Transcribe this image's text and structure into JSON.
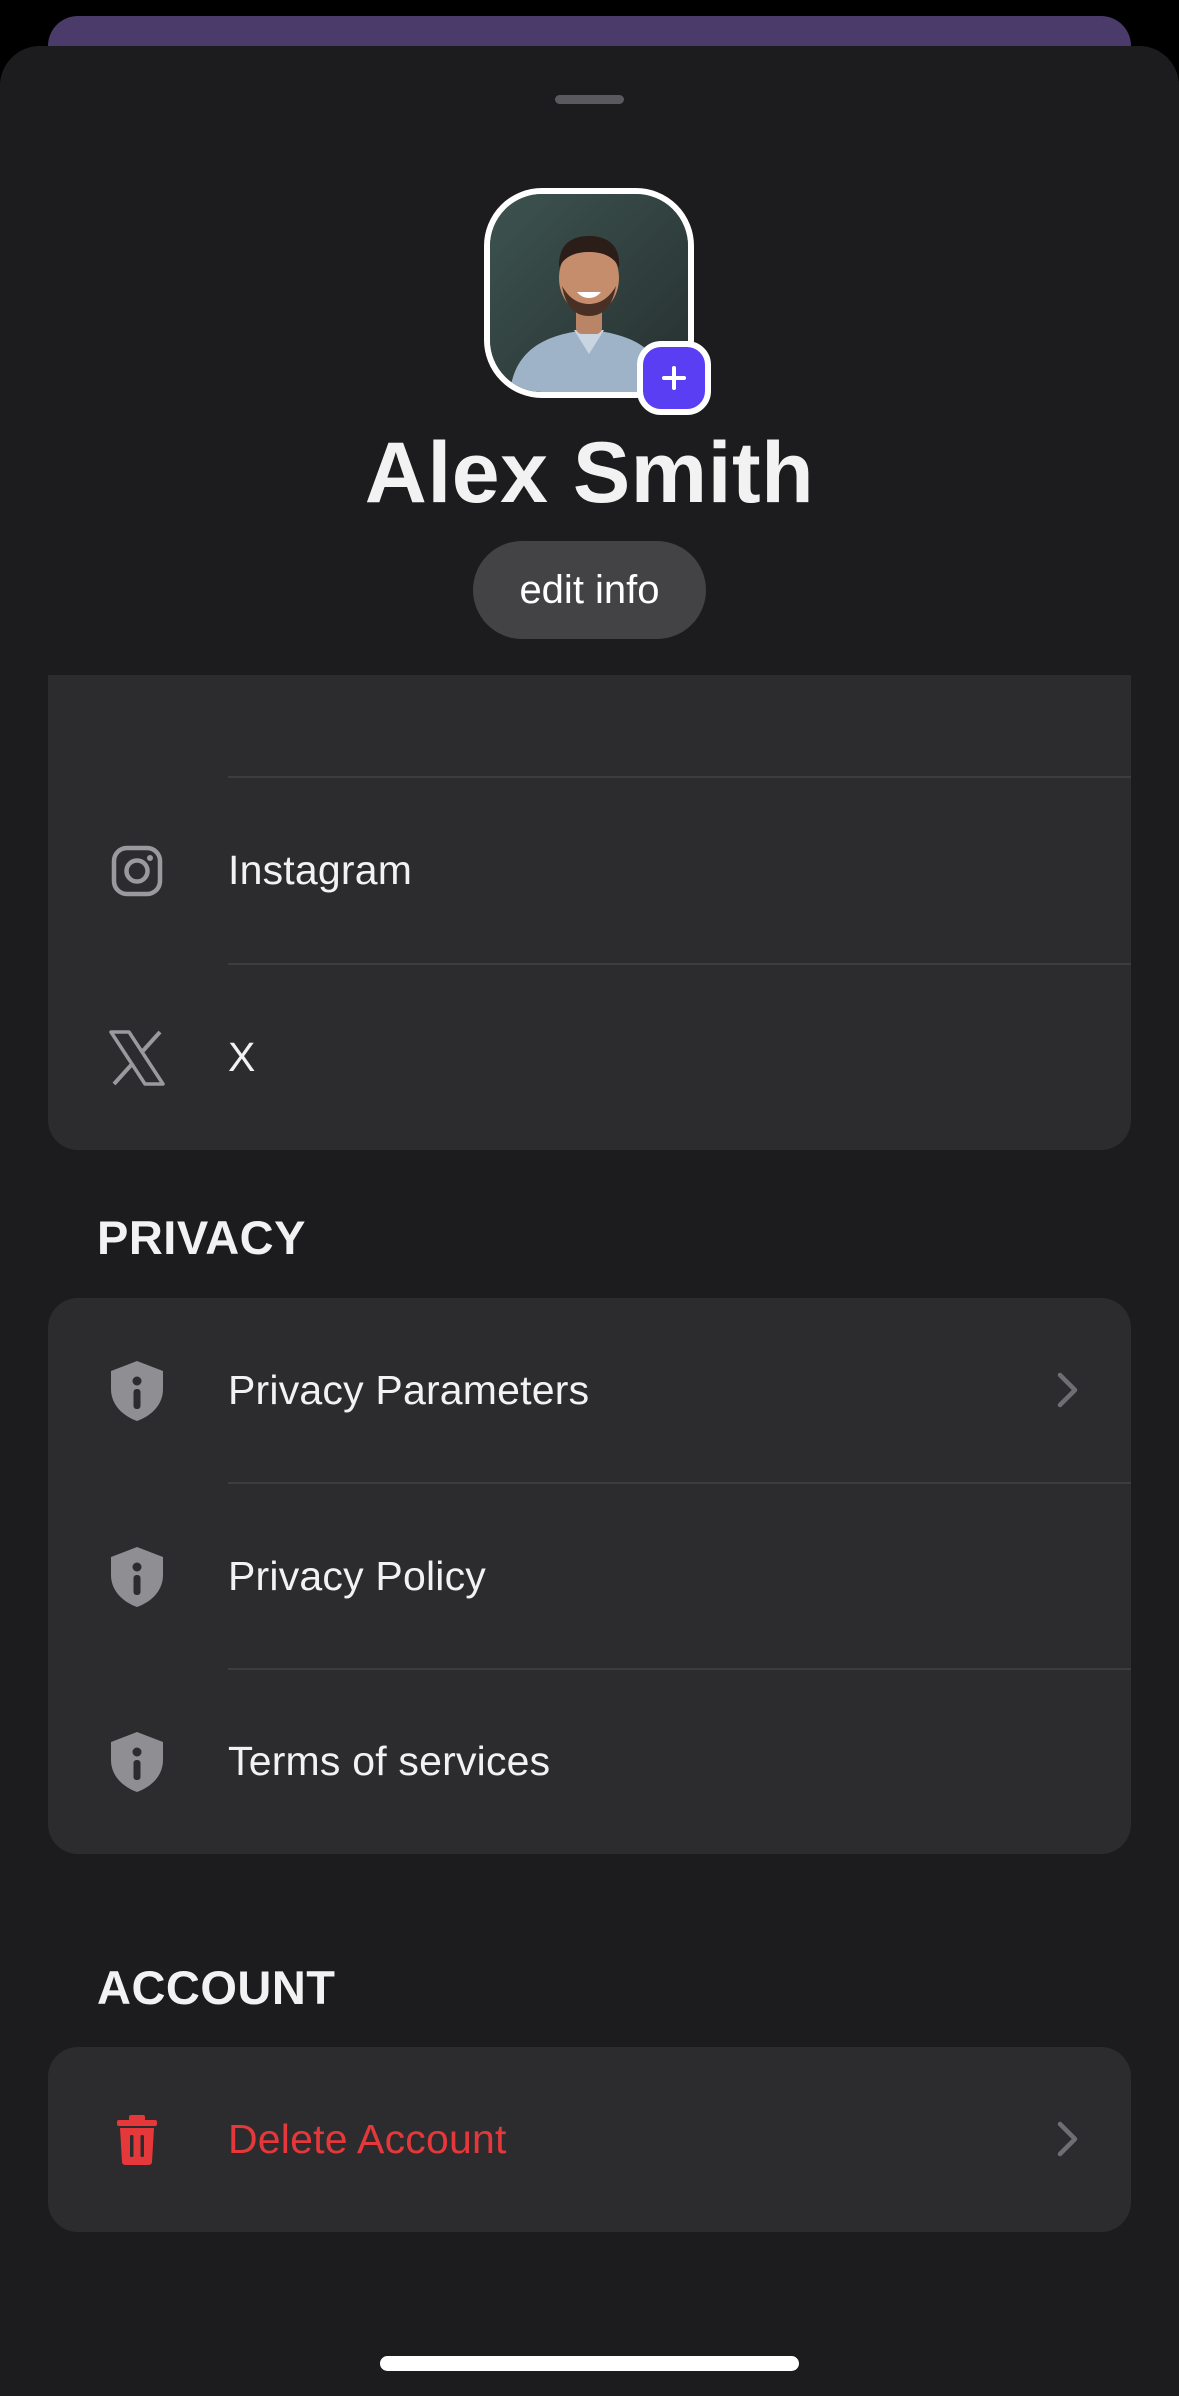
{
  "profile": {
    "name": "Alex Smith",
    "edit_label": "edit info"
  },
  "social": {
    "items": [
      {
        "label": "Instagram",
        "icon": "instagram-icon"
      },
      {
        "label": "X",
        "icon": "x-logo-icon"
      }
    ]
  },
  "privacy": {
    "header": "PRIVACY",
    "items": [
      {
        "label": "Privacy Parameters",
        "icon": "shield-info-icon",
        "has_chevron": true
      },
      {
        "label": "Privacy Policy",
        "icon": "shield-info-icon",
        "has_chevron": false
      },
      {
        "label": "Terms of services",
        "icon": "shield-info-icon",
        "has_chevron": false
      }
    ]
  },
  "account": {
    "header": "ACCOUNT",
    "items": [
      {
        "label": "Delete Account",
        "icon": "trash-icon",
        "has_chevron": true
      }
    ]
  },
  "colors": {
    "accent": "#5a3ef4",
    "danger": "#e5383b",
    "background": "#1c1c1e",
    "group": "#2c2c2e"
  }
}
